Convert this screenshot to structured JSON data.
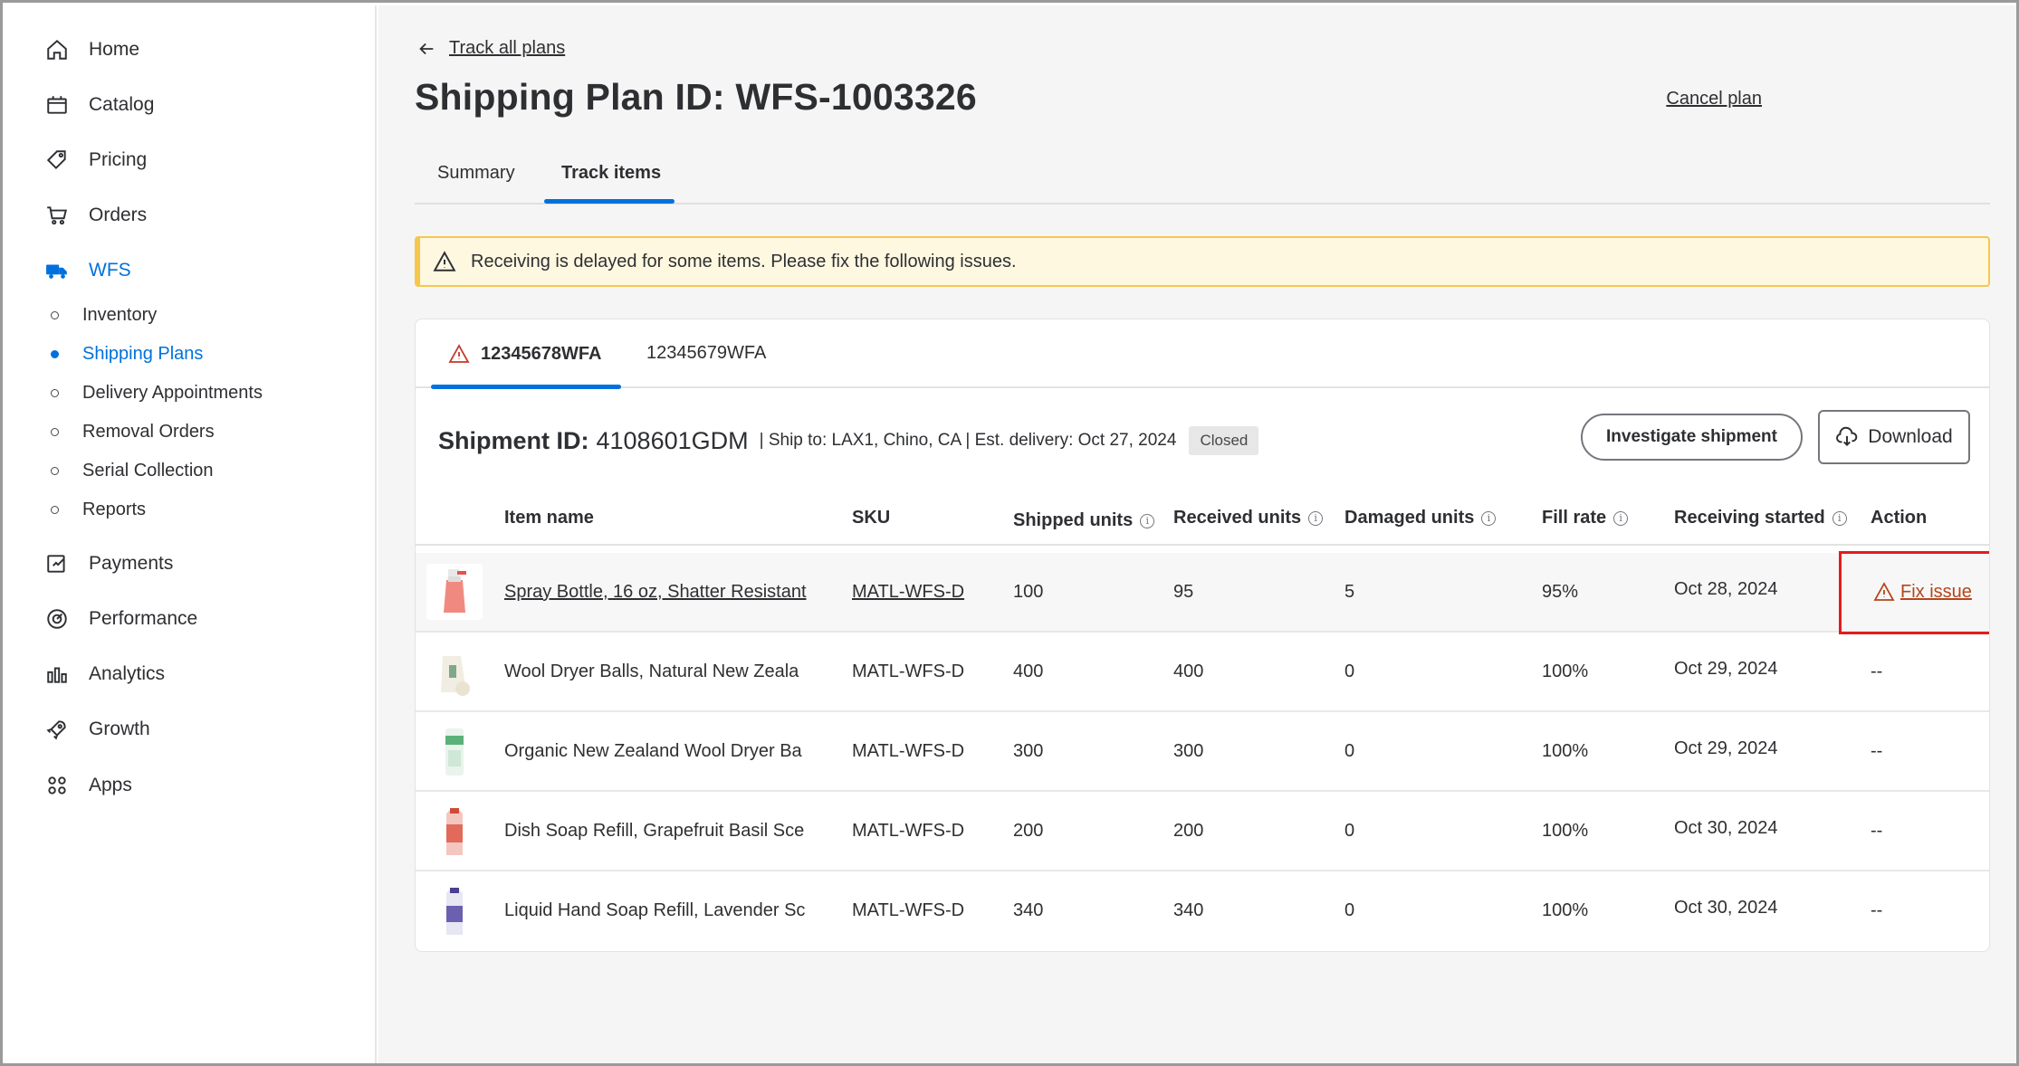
{
  "sidebar": {
    "items": [
      {
        "label": "Home",
        "icon": "home-icon"
      },
      {
        "label": "Catalog",
        "icon": "catalog-icon"
      },
      {
        "label": "Pricing",
        "icon": "price-tag-icon"
      },
      {
        "label": "Orders",
        "icon": "cart-icon"
      },
      {
        "label": "WFS",
        "icon": "truck-icon",
        "active": true
      },
      {
        "label": "Payments",
        "icon": "payments-icon"
      },
      {
        "label": "Performance",
        "icon": "performance-icon"
      },
      {
        "label": "Analytics",
        "icon": "analytics-icon"
      },
      {
        "label": "Growth",
        "icon": "rocket-icon"
      },
      {
        "label": "Apps",
        "icon": "apps-icon"
      }
    ],
    "wfs_sub": [
      {
        "label": "Inventory"
      },
      {
        "label": "Shipping Plans",
        "active": true
      },
      {
        "label": "Delivery Appointments"
      },
      {
        "label": "Removal Orders"
      },
      {
        "label": "Serial Collection"
      },
      {
        "label": "Reports"
      }
    ]
  },
  "header": {
    "back_label": "Track all plans",
    "title": "Shipping Plan ID: WFS-1003326",
    "cancel_label": "Cancel plan",
    "tabs": [
      {
        "label": "Summary"
      },
      {
        "label": "Track items",
        "active": true
      }
    ]
  },
  "alert": {
    "message": "Receiving is delayed for some items. Please fix the following issues."
  },
  "shipment": {
    "tabs": [
      {
        "label": "12345678WFA",
        "warning": true,
        "active": true
      },
      {
        "label": "12345679WFA"
      }
    ],
    "id_label": "Shipment ID:",
    "id_value": "4108601GDM",
    "meta": "| Ship to: LAX1, Chino, CA  |  Est. delivery: Oct 27, 2024",
    "status": "Closed",
    "investigate_label": "Investigate shipment",
    "download_label": "Download"
  },
  "table": {
    "headers": {
      "item": "Item name",
      "sku": "SKU",
      "shipped": "Shipped units",
      "received": "Received units",
      "damaged": "Damaged units",
      "fill": "Fill rate",
      "started": "Receiving started",
      "action": "Action"
    },
    "rows": [
      {
        "item": "Spray Bottle, 16 oz, Shatter Resistant",
        "sku": "MATL-WFS-D",
        "shipped": "100",
        "received": "95",
        "damaged": "5",
        "fill": "95%",
        "started": "Oct 28, 2024",
        "action": "Fix issue"
      },
      {
        "item": "Wool Dryer Balls, Natural New Zeala",
        "sku": "MATL-WFS-D",
        "shipped": "400",
        "received": "400",
        "damaged": "0",
        "fill": "100%",
        "started": "Oct 29, 2024",
        "action": "--"
      },
      {
        "item": "Organic New Zealand Wool Dryer Ba",
        "sku": "MATL-WFS-D",
        "shipped": "300",
        "received": "300",
        "damaged": "0",
        "fill": "100%",
        "started": "Oct 29, 2024",
        "action": "--"
      },
      {
        "item": "Dish Soap Refill, Grapefruit Basil Sce",
        "sku": "MATL-WFS-D",
        "shipped": "200",
        "received": "200",
        "damaged": "0",
        "fill": "100%",
        "started": "Oct 30, 2024",
        "action": "--"
      },
      {
        "item": "Liquid Hand Soap Refill, Lavender Sc",
        "sku": "MATL-WFS-D",
        "shipped": "340",
        "received": "340",
        "damaged": "0",
        "fill": "100%",
        "started": "Oct 30, 2024",
        "action": "--"
      }
    ]
  },
  "colors": {
    "accent": "#0071dc",
    "warning_bg": "#fff8e1",
    "warning_border": "#f5c84c",
    "highlight": "#e31c1c",
    "fix_text": "#b5451b"
  }
}
